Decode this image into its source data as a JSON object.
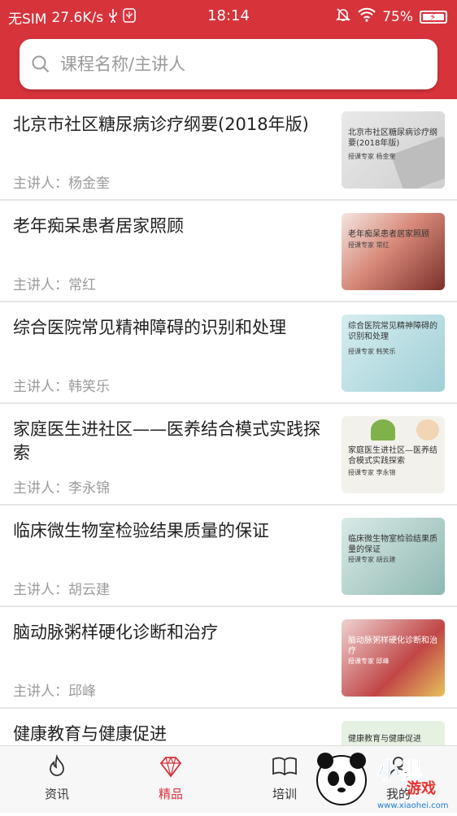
{
  "status_bar": {
    "carrier": "无SIM",
    "speed": "27.6K/s",
    "time": "18:14",
    "battery": "75%"
  },
  "search": {
    "placeholder": "课程名称/主讲人"
  },
  "courses": [
    {
      "title": "北京市社区糖尿病诊疗纲要(2018年版)",
      "lecturer": "主讲人：杨金奎",
      "thumb_title": "北京市社区糖尿病诊疗纲要(2018年版)",
      "thumb_sub": "授课专家  杨金奎"
    },
    {
      "title": "老年痴呆患者居家照顾",
      "lecturer": "主讲人：常红",
      "thumb_title": "老年痴呆患者居家照顾",
      "thumb_sub": "授课专家  常红"
    },
    {
      "title": "综合医院常见精神障碍的识别和处理",
      "lecturer": "主讲人：韩笑乐",
      "thumb_title": "综合医院常见精神障碍的识别和处理",
      "thumb_sub": "授课专家  韩笑乐"
    },
    {
      "title": "家庭医生进社区——医养结合模式实践探索",
      "lecturer": "主讲人：李永锦",
      "thumb_title": "家庭医生进社区—医养结合模式实践探索",
      "thumb_sub": "授课专家  李永锦"
    },
    {
      "title": "临床微生物室检验结果质量的保证",
      "lecturer": "主讲人：胡云建",
      "thumb_title": "临床微生物室检验结果质量的保证",
      "thumb_sub": "授课专家  胡云建"
    },
    {
      "title": "脑动脉粥样硬化诊断和治疗",
      "lecturer": "主讲人：邱峰",
      "thumb_title": "脑动脉粥样硬化诊断和治疗",
      "thumb_sub": "授课专家  邱峰"
    },
    {
      "title": "健康教育与健康促进",
      "lecturer": "",
      "thumb_title": "健康教育与健康促进",
      "thumb_sub": ""
    }
  ],
  "tabs": [
    {
      "label": "资讯",
      "icon": "flame-icon"
    },
    {
      "label": "精品",
      "icon": "diamond-icon"
    },
    {
      "label": "培训",
      "icon": "book-icon"
    },
    {
      "label": "我的",
      "icon": "user-icon"
    }
  ],
  "watermark": {
    "text": "小黑游戏",
    "url": "www.xiaohei.com"
  },
  "colors": {
    "brand": "#d6333b",
    "text": "#222222",
    "muted": "#9b9b9b"
  }
}
